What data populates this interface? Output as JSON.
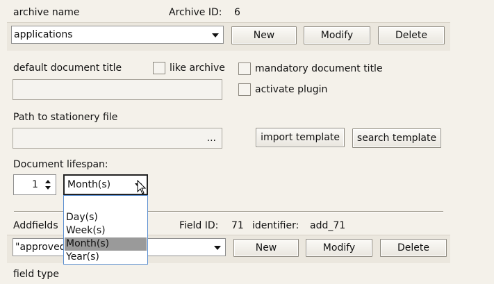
{
  "archive": {
    "name_label": "archive name",
    "id_label": "Archive ID:",
    "id_value": "6",
    "selected": "applications",
    "buttons": {
      "new": "New",
      "modify": "Modify",
      "delete": "Delete"
    }
  },
  "document": {
    "default_title_label": "default document title",
    "like_archive_label": "like archive",
    "like_archive_checked": false,
    "mandatory_title_label": "mandatory document title",
    "mandatory_title_checked": false,
    "activate_plugin_label": "activate plugin",
    "activate_plugin_checked": false,
    "default_title_value": ""
  },
  "stationery": {
    "path_label": "Path to stationery file",
    "path_value": "",
    "browse_label": "...",
    "import_label": "import template",
    "search_label": "search template"
  },
  "lifespan": {
    "label": "Document lifespan:",
    "amount": "1",
    "unit_selected": "Month(s)",
    "options": [
      "Day(s)",
      "Week(s)",
      "Month(s)",
      "Year(s)"
    ],
    "highlighted_index": 2
  },
  "addfields": {
    "label": "Addfields",
    "field_id_label": "Field ID:",
    "field_id_value": "71",
    "identifier_label": "identifier:",
    "identifier_value": "add_71",
    "selected": "\"approved",
    "buttons": {
      "new": "New",
      "modify": "Modify",
      "delete": "Delete"
    },
    "field_type_label": "field type"
  },
  "icons": {
    "lifespan_stepper": "spin-up-down-icon",
    "mouse_cursor": "arrow-cursor-icon"
  }
}
